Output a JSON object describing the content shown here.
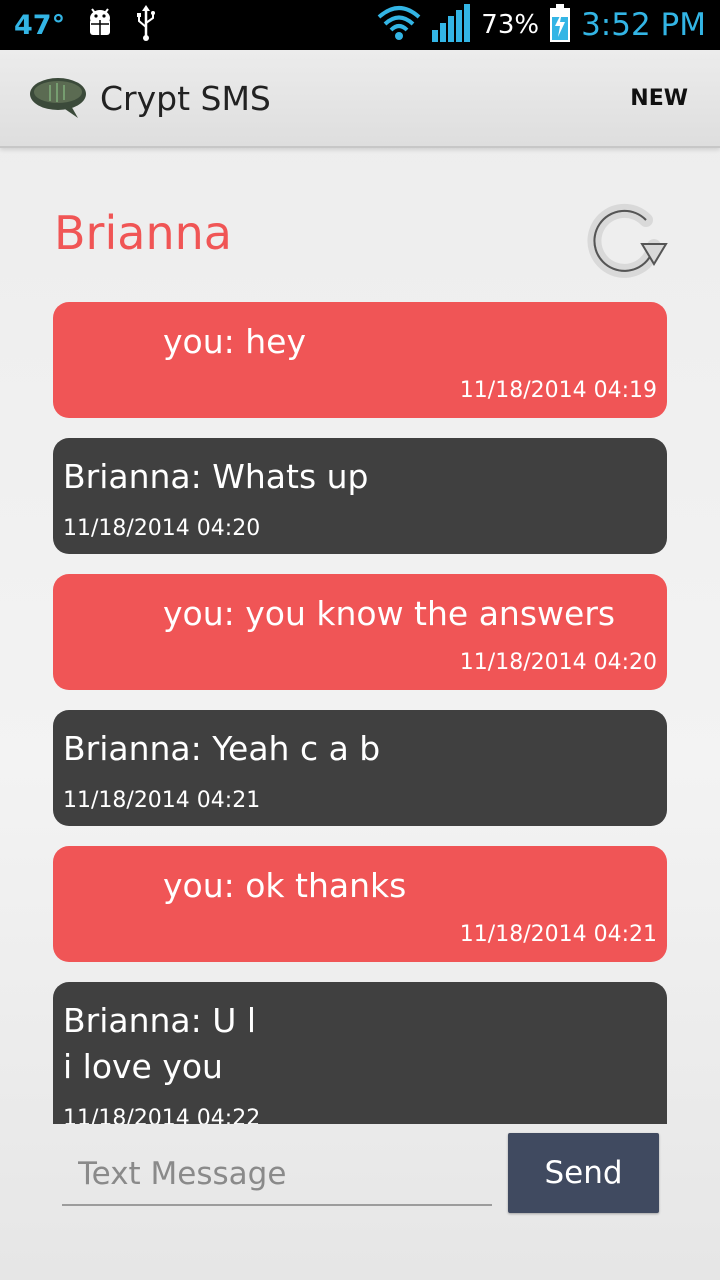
{
  "status_bar": {
    "temperature": "47°",
    "battery_percent": "73%",
    "time": "3:52 PM",
    "accent_color": "#33b5e5"
  },
  "action_bar": {
    "title": "Crypt SMS",
    "new_label": "NEW"
  },
  "conversation": {
    "contact_name": "Brianna",
    "messages": [
      {
        "direction": "sent",
        "text": "you: hey",
        "timestamp": "11/18/2014 04:19"
      },
      {
        "direction": "received",
        "text": "Brianna: Whats up",
        "timestamp": "11/18/2014 04:20"
      },
      {
        "direction": "sent",
        "text": "you: you know the answers",
        "timestamp": "11/18/2014 04:20"
      },
      {
        "direction": "received",
        "text": "Brianna: Yeah c a b",
        "timestamp": "11/18/2014 04:21"
      },
      {
        "direction": "sent",
        "text": "you: ok thanks",
        "timestamp": "11/18/2014 04:21"
      },
      {
        "direction": "received",
        "text": "Brianna: U l\ni love you",
        "timestamp": "11/18/2014 04:22"
      }
    ]
  },
  "composer": {
    "placeholder": "Text Message",
    "value": "",
    "send_label": "Send"
  },
  "colors": {
    "sent_bubble": "#f05556",
    "received_bubble": "#404040",
    "contact_name": "#f05555",
    "send_button": "#404a60"
  },
  "icons": {
    "status_android": "android-debug-icon",
    "status_usb": "usb-icon",
    "status_wifi": "wifi-icon",
    "status_signal": "signal-bars-icon",
    "status_battery": "battery-charging-icon",
    "app": "speech-bubble-icon",
    "refresh": "refresh-icon"
  }
}
